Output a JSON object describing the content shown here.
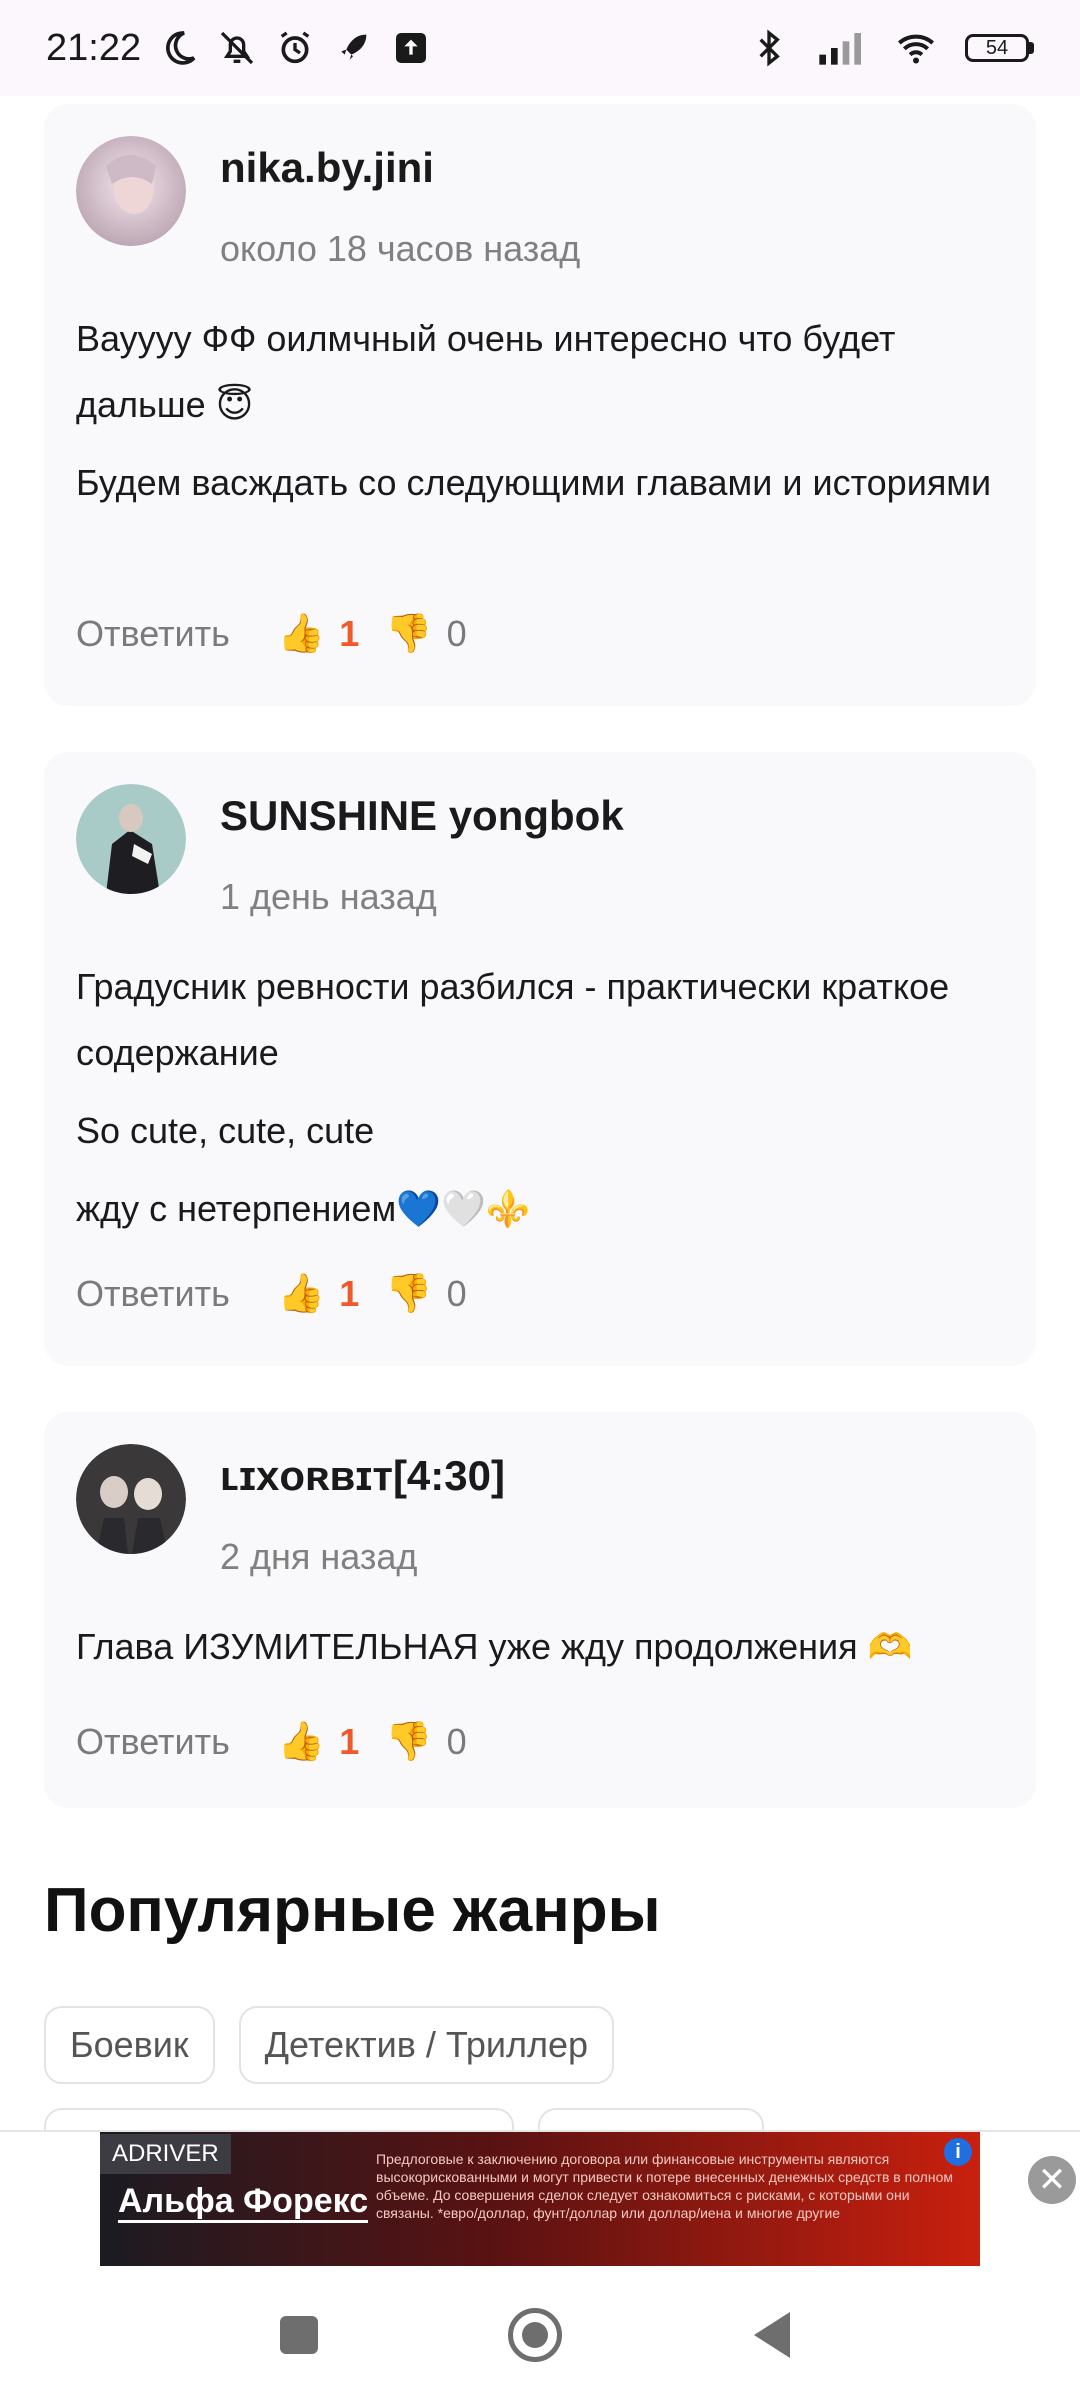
{
  "status_bar": {
    "time": "21:22",
    "battery": "54"
  },
  "comments": [
    {
      "author": "nika.by.jini",
      "time": "около 18 часов назад",
      "text": [
        "Ваууyy ФФ оилмчный очень интересно что будет дальше 😇",
        "Будем васждать со следующими главами и историями"
      ],
      "reply_label": "Ответить",
      "likes": "1",
      "dislikes": "0"
    },
    {
      "author": "SUNSHINE yongbok",
      "time": "1 день назад",
      "text": [
        "Градусник ревности разбился - практически краткое содержание",
        "So cute, cute, cute",
        "жду с нетерпением💙🤍⚜️"
      ],
      "reply_label": "Ответить",
      "likes": "1",
      "dislikes": "0"
    },
    {
      "author": "ʟɪxᴏʀʙɪᴛ[4:30]",
      "time": "2 дня назад",
      "text": [
        "Глава ИЗУМИТЕЛЬНАЯ уже жду продолжения 🫶"
      ],
      "reply_label": "Ответить",
      "likes": "1",
      "dislikes": "0"
    }
  ],
  "genres": {
    "title": "Популярные жанры",
    "items": [
      "Боевик",
      "Детектив / Триллер"
    ]
  },
  "ad": {
    "tag": "ADRIVER",
    "brand": "Альфа Форекс",
    "text": "Предлоговые к заключению договора или финансовые инструменты являются высокорискованными и могут привести к потере внесенных денежных средств в полном объеме. До совершения сделок следует ознакомиться с рисками, с которыми они связаны. *еврo/доллар, фунт/доллар или доллар/иена и многие другие",
    "info": "i",
    "close": "✕"
  }
}
